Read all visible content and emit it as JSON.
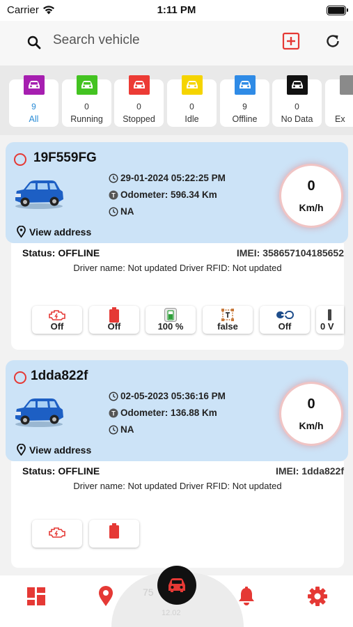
{
  "status_bar": {
    "carrier": "Carrier",
    "time": "1:11 PM"
  },
  "search": {
    "placeholder": "Search vehicle"
  },
  "colors": {
    "accent": "#e53935",
    "card_bg": "#cce3f7",
    "link": "#2a8cd6"
  },
  "filters": [
    {
      "count": "9",
      "label": "All",
      "color": "#a61fb0"
    },
    {
      "count": "0",
      "label": "Running",
      "color": "#43c321"
    },
    {
      "count": "0",
      "label": "Stopped",
      "color": "#ec3b35"
    },
    {
      "count": "0",
      "label": "Idle",
      "color": "#f5d400"
    },
    {
      "count": "9",
      "label": "Offline",
      "color": "#2f8be6"
    },
    {
      "count": "0",
      "label": "No Data",
      "color": "#111111"
    },
    {
      "count": "",
      "label": "Ex",
      "color": "#8a8a8a"
    }
  ],
  "vehicles": [
    {
      "name": "19F559FG",
      "datetime": "29-01-2024 05:22:25 PM",
      "odometer": "Odometer: 596.34 Km",
      "location": "NA",
      "view_address": "View address",
      "speed": "0",
      "speed_unit": "Km/h",
      "status": "Status: OFFLINE",
      "imei": "IMEI: 358657104185652",
      "driver": "Driver name: Not updated Driver RFID: Not updated",
      "sensors": [
        {
          "icon": "engine-icon",
          "label": "Off"
        },
        {
          "icon": "battery-icon",
          "label": "Off"
        },
        {
          "icon": "battery-level-icon",
          "label": "100 %"
        },
        {
          "icon": "sensor-icon",
          "label": "false"
        },
        {
          "icon": "link-icon",
          "label": "Off"
        },
        {
          "icon": "voltage-icon",
          "label": "0 V"
        }
      ]
    },
    {
      "name": "1dda822f",
      "datetime": "02-05-2023 05:36:16 PM",
      "odometer": "Odometer: 136.88 Km",
      "location": "NA",
      "view_address": "View address",
      "speed": "0",
      "speed_unit": "Km/h",
      "status": "Status: OFFLINE",
      "imei": "IMEI: 1dda822f",
      "driver": "Driver name: Not updated Driver RFID: Not updated",
      "sensors": [
        {
          "icon": "engine-icon",
          "label": ""
        },
        {
          "icon": "battery-icon",
          "label": ""
        }
      ]
    }
  ],
  "nav": {
    "items": [
      "dashboard-icon",
      "location-icon",
      "vehicles-icon",
      "notifications-icon",
      "settings-icon"
    ],
    "ghost_text": "75",
    "ghost_text_2": "12.02"
  }
}
